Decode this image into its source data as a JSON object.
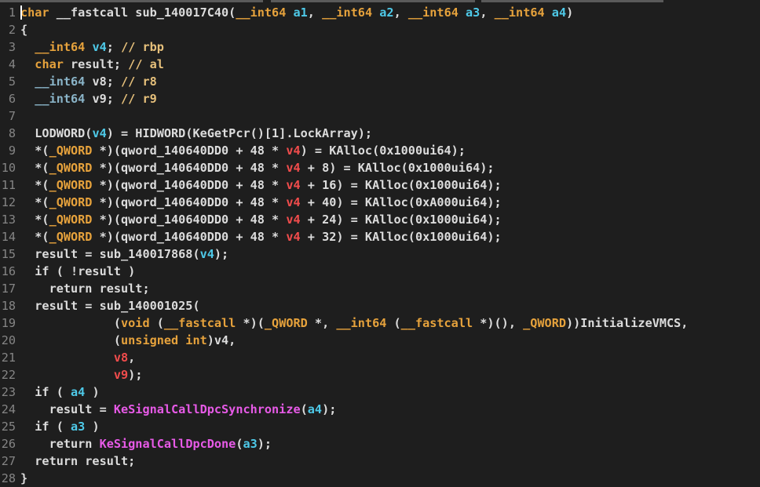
{
  "editor": {
    "colors": {
      "background": "#1e1e1e",
      "keyword": "#e6a23c",
      "argument": "#4ec9e8",
      "local": "#f14c4c",
      "api": "#e75ae7",
      "plain": "#dcdcdc",
      "line_number": "#858585"
    },
    "lines": [
      {
        "num": "1",
        "tokens": [
          [
            "type",
            "char"
          ],
          [
            "plain",
            " __fastcall sub_140017C40("
          ],
          [
            "type",
            "__int64"
          ],
          [
            "plain",
            " "
          ],
          [
            "var",
            "a1"
          ],
          [
            "plain",
            ", "
          ],
          [
            "type",
            "__int64"
          ],
          [
            "plain",
            " "
          ],
          [
            "var",
            "a2"
          ],
          [
            "plain",
            ", "
          ],
          [
            "type",
            "__int64"
          ],
          [
            "plain",
            " "
          ],
          [
            "var",
            "a3"
          ],
          [
            "plain",
            ", "
          ],
          [
            "type",
            "__int64"
          ],
          [
            "plain",
            " "
          ],
          [
            "var",
            "a4"
          ],
          [
            "plain",
            ")"
          ]
        ]
      },
      {
        "num": "2",
        "tokens": [
          [
            "plain",
            "{"
          ]
        ]
      },
      {
        "num": "3",
        "tokens": [
          [
            "plain",
            "  "
          ],
          [
            "type",
            "__int64"
          ],
          [
            "plain",
            " "
          ],
          [
            "var",
            "v4"
          ],
          [
            "plain",
            "; "
          ],
          [
            "cmt",
            "// rbp"
          ]
        ]
      },
      {
        "num": "4",
        "tokens": [
          [
            "plain",
            "  "
          ],
          [
            "type",
            "char"
          ],
          [
            "plain",
            " result; "
          ],
          [
            "cmt",
            "// al"
          ]
        ]
      },
      {
        "num": "5",
        "tokens": [
          [
            "plain",
            "  "
          ],
          [
            "typefaint",
            "__int64"
          ],
          [
            "plain",
            " v8; "
          ],
          [
            "cmt",
            "// r8"
          ]
        ]
      },
      {
        "num": "6",
        "tokens": [
          [
            "plain",
            "  "
          ],
          [
            "typefaint",
            "__int64"
          ],
          [
            "plain",
            " v9; "
          ],
          [
            "cmt",
            "// r9"
          ]
        ]
      },
      {
        "num": "7",
        "tokens": []
      },
      {
        "num": "8",
        "tokens": [
          [
            "plain",
            "  LODWORD("
          ],
          [
            "var",
            "v4"
          ],
          [
            "plain",
            ") = HIDWORD(KeGetPcr()[1].LockArray);"
          ]
        ]
      },
      {
        "num": "9",
        "tokens": [
          [
            "plain",
            "  *("
          ],
          [
            "type",
            "_QWORD"
          ],
          [
            "plain",
            " *)(qword_140640DD0 + 48 * "
          ],
          [
            "local",
            "v4"
          ],
          [
            "plain",
            ") = KAlloc(0x1000ui64);"
          ]
        ]
      },
      {
        "num": "10",
        "tokens": [
          [
            "plain",
            "  *("
          ],
          [
            "type",
            "_QWORD"
          ],
          [
            "plain",
            " *)(qword_140640DD0 + 48 * "
          ],
          [
            "local",
            "v4"
          ],
          [
            "plain",
            " + 8) = KAlloc(0x1000ui64);"
          ]
        ]
      },
      {
        "num": "11",
        "tokens": [
          [
            "plain",
            "  *("
          ],
          [
            "type",
            "_QWORD"
          ],
          [
            "plain",
            " *)(qword_140640DD0 + 48 * "
          ],
          [
            "local",
            "v4"
          ],
          [
            "plain",
            " + 16) = KAlloc(0x1000ui64);"
          ]
        ]
      },
      {
        "num": "12",
        "tokens": [
          [
            "plain",
            "  *("
          ],
          [
            "type",
            "_QWORD"
          ],
          [
            "plain",
            " *)(qword_140640DD0 + 48 * "
          ],
          [
            "local",
            "v4"
          ],
          [
            "plain",
            " + 40) = KAlloc(0xA000ui64);"
          ]
        ]
      },
      {
        "num": "13",
        "tokens": [
          [
            "plain",
            "  *("
          ],
          [
            "type",
            "_QWORD"
          ],
          [
            "plain",
            " *)(qword_140640DD0 + 48 * "
          ],
          [
            "local",
            "v4"
          ],
          [
            "plain",
            " + 24) = KAlloc(0x1000ui64);"
          ]
        ]
      },
      {
        "num": "14",
        "tokens": [
          [
            "plain",
            "  *("
          ],
          [
            "type",
            "_QWORD"
          ],
          [
            "plain",
            " *)(qword_140640DD0 + 48 * "
          ],
          [
            "local",
            "v4"
          ],
          [
            "plain",
            " + 32) = KAlloc(0x1000ui64);"
          ]
        ]
      },
      {
        "num": "15",
        "tokens": [
          [
            "plain",
            "  result = sub_140017868("
          ],
          [
            "var",
            "v4"
          ],
          [
            "plain",
            ");"
          ]
        ]
      },
      {
        "num": "16",
        "tokens": [
          [
            "plain",
            "  if ( !result )"
          ]
        ]
      },
      {
        "num": "17",
        "tokens": [
          [
            "plain",
            "    return result;"
          ]
        ]
      },
      {
        "num": "18",
        "tokens": [
          [
            "plain",
            "  result = sub_140001025("
          ]
        ]
      },
      {
        "num": "19",
        "tokens": [
          [
            "plain",
            "             ("
          ],
          [
            "type",
            "void"
          ],
          [
            "plain",
            " ("
          ],
          [
            "type",
            "__fastcall"
          ],
          [
            "plain",
            " *)("
          ],
          [
            "type",
            "_QWORD"
          ],
          [
            "plain",
            " *, "
          ],
          [
            "type",
            "__int64"
          ],
          [
            "plain",
            " ("
          ],
          [
            "type",
            "__fastcall"
          ],
          [
            "plain",
            " *)(), "
          ],
          [
            "type",
            "_QWORD"
          ],
          [
            "plain",
            "))InitializeVMCS,"
          ]
        ]
      },
      {
        "num": "20",
        "tokens": [
          [
            "plain",
            "             ("
          ],
          [
            "type",
            "unsigned int"
          ],
          [
            "plain",
            ")v4,"
          ]
        ]
      },
      {
        "num": "21",
        "tokens": [
          [
            "plain",
            "             "
          ],
          [
            "local",
            "v8"
          ],
          [
            "plain",
            ","
          ]
        ]
      },
      {
        "num": "22",
        "tokens": [
          [
            "plain",
            "             "
          ],
          [
            "local",
            "v9"
          ],
          [
            "plain",
            ");"
          ]
        ]
      },
      {
        "num": "23",
        "tokens": [
          [
            "plain",
            "  if ( "
          ],
          [
            "var",
            "a4"
          ],
          [
            "plain",
            " )"
          ]
        ]
      },
      {
        "num": "24",
        "tokens": [
          [
            "plain",
            "    result = "
          ],
          [
            "api",
            "KeSignalCallDpcSynchronize"
          ],
          [
            "plain",
            "("
          ],
          [
            "var",
            "a4"
          ],
          [
            "plain",
            ");"
          ]
        ]
      },
      {
        "num": "25",
        "tokens": [
          [
            "plain",
            "  if ( "
          ],
          [
            "var",
            "a3"
          ],
          [
            "plain",
            " )"
          ]
        ]
      },
      {
        "num": "26",
        "tokens": [
          [
            "plain",
            "    return "
          ],
          [
            "api",
            "KeSignalCallDpcDone"
          ],
          [
            "plain",
            "("
          ],
          [
            "var",
            "a3"
          ],
          [
            "plain",
            ");"
          ]
        ]
      },
      {
        "num": "27",
        "tokens": [
          [
            "plain",
            "  return result;"
          ]
        ]
      },
      {
        "num": "28",
        "tokens": [
          [
            "plain",
            "}"
          ]
        ]
      }
    ]
  }
}
